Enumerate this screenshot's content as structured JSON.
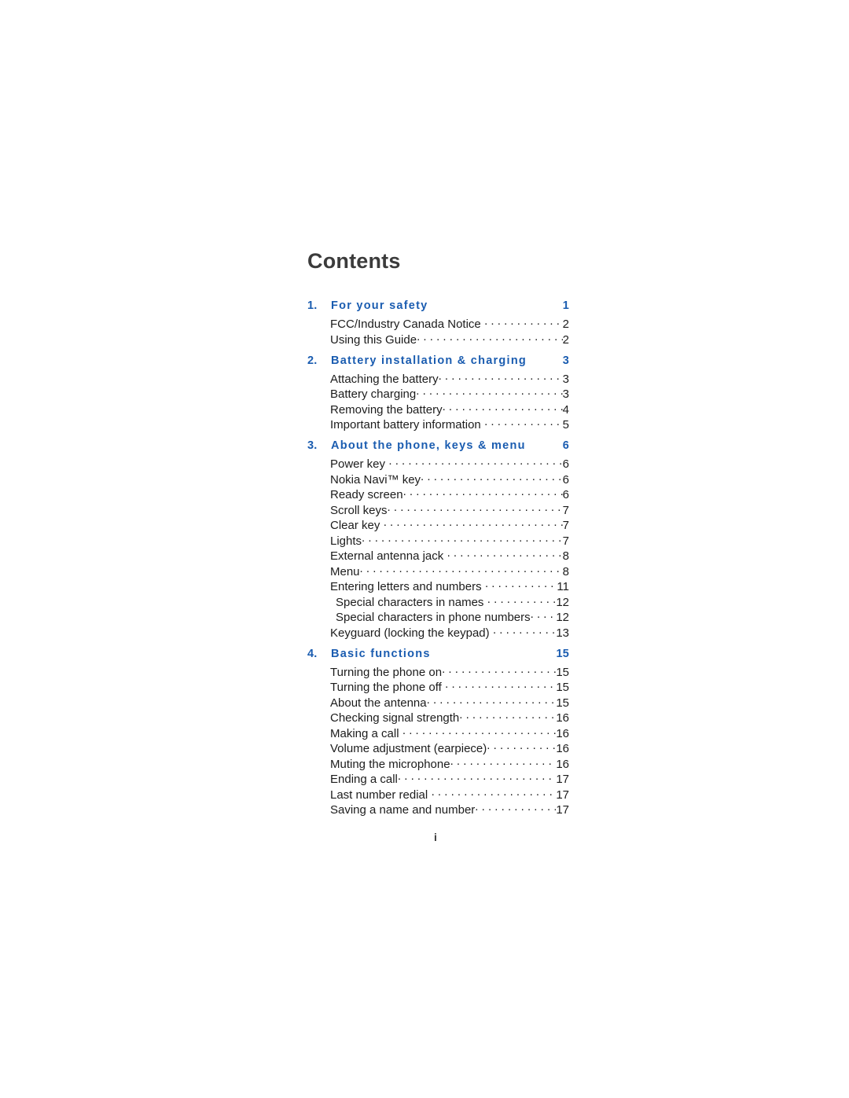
{
  "document": {
    "title": "Contents",
    "folio": "i"
  },
  "toc": {
    "groups": [
      {
        "chapter_number": "1.",
        "chapter_title": "For your safety",
        "chapter_page": "1",
        "entries": [
          {
            "label": "FCC/Industry Canada Notice",
            "page": "2",
            "level": 1,
            "tight": true
          },
          {
            "label": "Using this Guide",
            "page": "2",
            "level": 1,
            "tight": false
          }
        ]
      },
      {
        "chapter_number": "2.",
        "chapter_title": "Battery installation & charging",
        "chapter_page": "3",
        "entries": [
          {
            "label": "Attaching the battery",
            "page": "3",
            "level": 1,
            "tight": false
          },
          {
            "label": "Battery charging",
            "page": "3",
            "level": 1,
            "tight": false
          },
          {
            "label": "Removing the battery",
            "page": "4",
            "level": 1,
            "tight": false
          },
          {
            "label": "Important battery information",
            "page": "5",
            "level": 1,
            "tight": true
          }
        ]
      },
      {
        "chapter_number": "3.",
        "chapter_title": "About the phone, keys & menu",
        "chapter_page": "6",
        "entries": [
          {
            "label": "Power key",
            "page": "6",
            "level": 1,
            "tight": true
          },
          {
            "label": "Nokia Navi™ key",
            "page": "6",
            "level": 1,
            "tight": false
          },
          {
            "label": "Ready screen",
            "page": "6",
            "level": 1,
            "tight": false
          },
          {
            "label": "Scroll keys",
            "page": "7",
            "level": 1,
            "tight": false
          },
          {
            "label": "Clear key",
            "page": "7",
            "level": 1,
            "tight": true
          },
          {
            "label": "Lights",
            "page": "7",
            "level": 1,
            "tight": false
          },
          {
            "label": "External antenna jack",
            "page": "8",
            "level": 1,
            "tight": true
          },
          {
            "label": "Menu",
            "page": "8",
            "level": 1,
            "tight": false
          },
          {
            "label": "Entering letters and numbers",
            "page": "11",
            "level": 1,
            "tight": true
          },
          {
            "label": "Special characters in names",
            "page": "12",
            "level": 2,
            "tight": true
          },
          {
            "label": "Special characters in phone numbers",
            "page": "12",
            "level": 2,
            "tight": false
          },
          {
            "label": "Keyguard (locking the keypad)",
            "page": "13",
            "level": 1,
            "tight": true
          }
        ]
      },
      {
        "chapter_number": "4.",
        "chapter_title": "Basic functions",
        "chapter_page": "15",
        "entries": [
          {
            "label": "Turning the phone on",
            "page": "15",
            "level": 1,
            "tight": false
          },
          {
            "label": "Turning the phone off",
            "page": "15",
            "level": 1,
            "tight": true
          },
          {
            "label": "About the antenna",
            "page": "15",
            "level": 1,
            "tight": false
          },
          {
            "label": "Checking signal strength",
            "page": "16",
            "level": 1,
            "tight": false
          },
          {
            "label": "Making a call",
            "page": "16",
            "level": 1,
            "tight": true
          },
          {
            "label": "Volume adjustment (earpiece)",
            "page": "16",
            "level": 1,
            "tight": false
          },
          {
            "label": "Muting the microphone",
            "page": "16",
            "level": 1,
            "tight": false
          },
          {
            "label": "Ending a call",
            "page": "17",
            "level": 1,
            "tight": false
          },
          {
            "label": "Last number redial",
            "page": "17",
            "level": 1,
            "tight": true
          },
          {
            "label": "Saving a name and number",
            "page": "17",
            "level": 1,
            "tight": false
          }
        ]
      }
    ]
  },
  "theme": {
    "accent_blue": "#1a5cb0",
    "body_text": "#1c1c1c",
    "title_text": "#3b3b3b",
    "page_background": "#ffffff"
  }
}
